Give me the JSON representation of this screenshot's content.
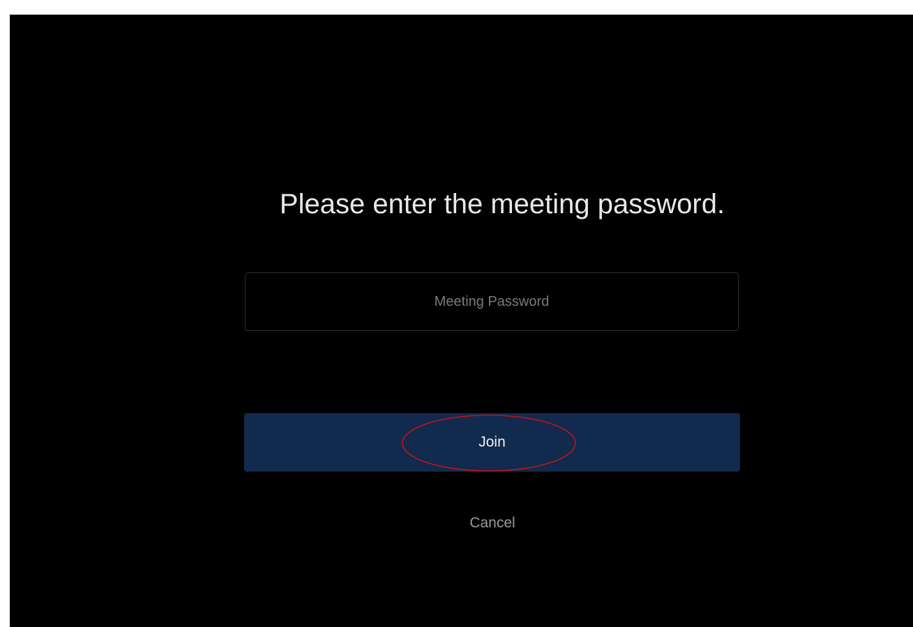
{
  "dialog": {
    "prompt": "Please enter the meeting password.",
    "password_field": {
      "placeholder": "Meeting Password",
      "value": ""
    },
    "join_label": "Join",
    "cancel_label": "Cancel"
  },
  "colors": {
    "background": "#000000",
    "join_button": "#112a4d",
    "annotation": "#c0141c"
  }
}
